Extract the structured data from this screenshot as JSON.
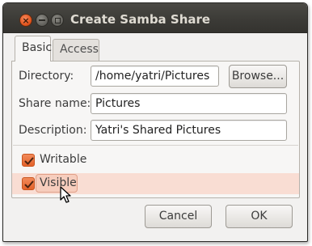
{
  "window": {
    "title": "Create Samba Share",
    "controls": [
      "close-icon",
      "minimize-icon",
      "maximize-icon"
    ]
  },
  "tabs": [
    {
      "label": "Basic",
      "active": true
    },
    {
      "label": "Access",
      "active": false
    }
  ],
  "form": {
    "directory_label": "Directory:",
    "directory_value": "/home/yatri/Pictures",
    "browse_label": "Browse...",
    "share_name_label": "Share name:",
    "share_name_value": "Pictures",
    "description_label": "Description:",
    "description_value": "Yatri's Shared Pictures"
  },
  "options": [
    {
      "label": "Writable",
      "checked": true,
      "highlighted": false
    },
    {
      "label": "Visible",
      "checked": true,
      "highlighted": true
    }
  ],
  "footer": {
    "cancel_label": "Cancel",
    "ok_label": "OK"
  },
  "colors": {
    "accent": "#e4622a",
    "titlebar": "#3c3b37",
    "highlight": "#f9ddd3"
  }
}
